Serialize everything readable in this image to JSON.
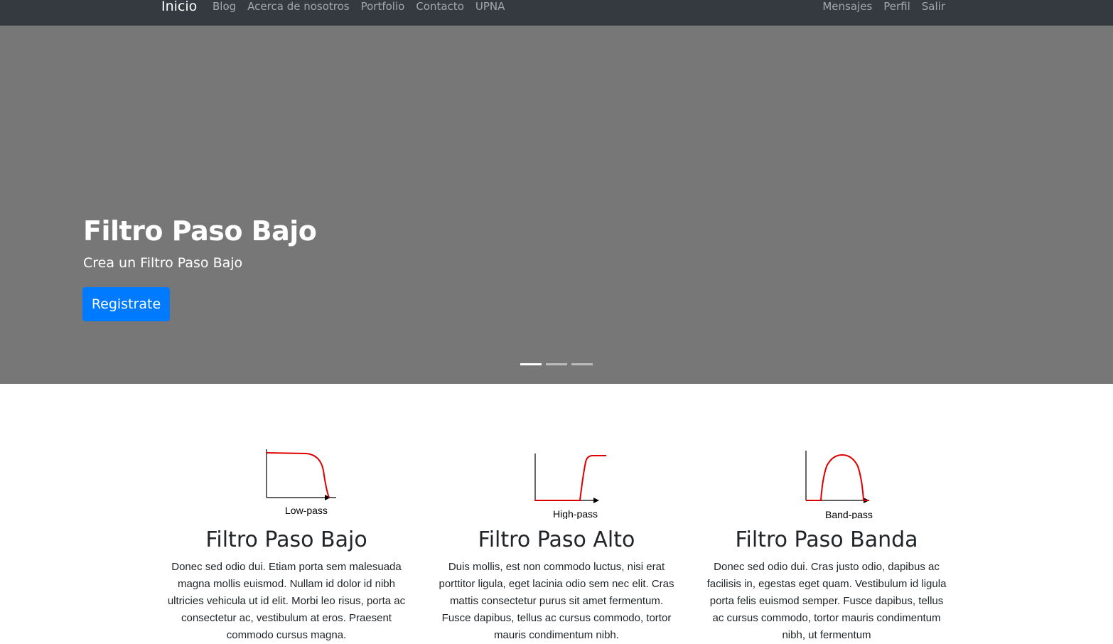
{
  "navbar": {
    "brand": "Inicio",
    "left_links": [
      "Blog",
      "Acerca de nosotros",
      "Portfolio",
      "Contacto",
      "UPNA"
    ],
    "right_links": [
      "Mensajes",
      "Perfil",
      "Salir"
    ],
    "background": "#343a40"
  },
  "hero": {
    "title": "Filtro Paso Bajo",
    "subtitle": "Crea un Filtro Paso Bajo",
    "button_label": "Registrate",
    "background": "#777777",
    "button_color": "#007bff",
    "slides": 3,
    "active_slide": 1
  },
  "features": [
    {
      "caption": "Low-pass",
      "title": "Filtro Paso Bajo",
      "text": "Donec sed odio dui. Etiam porta sem malesuada magna mollis euismod. Nullam id dolor id nibh ultricies vehicula ut id elit. Morbi leo risus, porta ac consectetur ac, vestibulum at eros. Praesent commodo cursus magna."
    },
    {
      "caption": "High-pass",
      "title": "Filtro Paso Alto",
      "text": "Duis mollis, est non commodo luctus, nisi erat porttitor ligula, eget lacinia odio sem nec elit. Cras mattis consectetur purus sit amet fermentum. Fusce dapibus, tellus ac cursus commodo, tortor mauris condimentum nibh."
    },
    {
      "caption": "Band-pass",
      "title": "Filtro Paso Banda",
      "text": "Donec sed odio dui. Cras justo odio, dapibus ac facilisis in, egestas eget quam. Vestibulum id ligula porta felis euismod semper. Fusce dapibus, tellus ac cursus commodo, tortor mauris condimentum nibh, ut fermentum"
    }
  ],
  "curve_color": "#dd0000"
}
